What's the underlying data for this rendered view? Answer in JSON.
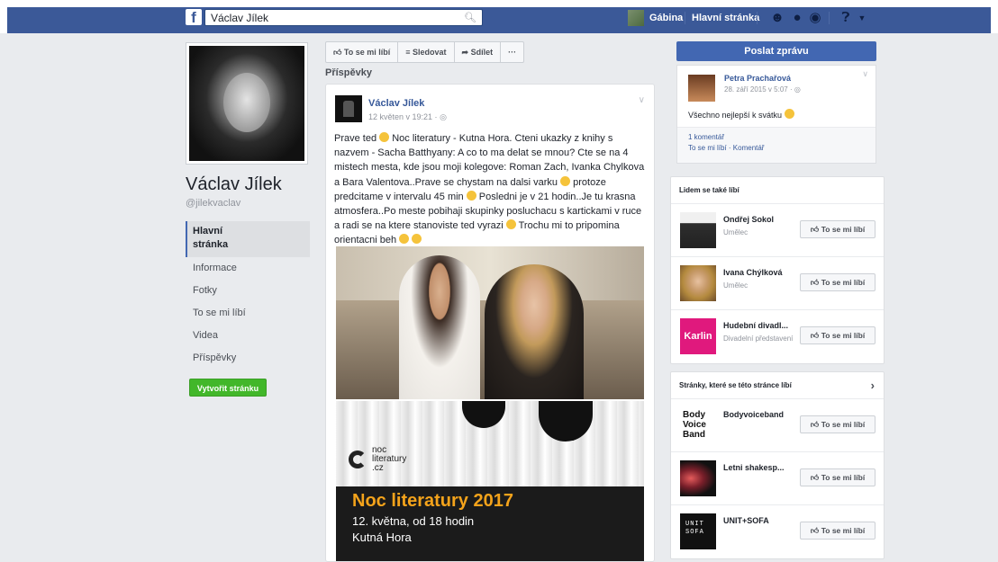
{
  "topbar": {
    "logo": "f",
    "search_value": "Václav Jílek",
    "user_name": "Gábina",
    "home_label": "Hlavní stránka",
    "colors": {
      "blue": "#3b5998",
      "green": "#42b72a"
    }
  },
  "page": {
    "name": "Václav Jílek",
    "handle": "@jilekvaclav"
  },
  "leftnav": {
    "items": [
      {
        "label": "Hlavní\nstránka",
        "active": true
      },
      {
        "label": "Informace"
      },
      {
        "label": "Fotky"
      },
      {
        "label": "To se mi líbí"
      },
      {
        "label": "Videa"
      },
      {
        "label": "Příspěvky"
      }
    ],
    "create_button": "Vytvořit stránku"
  },
  "actions": {
    "like": "To se mi líbí",
    "follow": "Sledovat",
    "share": "Sdílet",
    "more": "···"
  },
  "posts_title": "Příspěvky",
  "post": {
    "author": "Václav Jílek",
    "time": "12 květen v 19:21 · ",
    "text_parts": [
      "Prave ted ",
      " Noc literatury - Kutna Hora. Cteni ukazky z knihy s nazvem - Sacha Batthyany: A co to ma delat se mnou? Cte se na 4 mistech mesta, kde jsou moji kolegove: Roman Zach, Ivanka Chylkova a Bara Valentova..Prave se chystam na dalsi varku ",
      " protoze predcitame v intervalu 45 min ",
      " Posledni je v 21 hodin..Je tu krasna atmosfera..Po meste pobihaji skupinky posluchacu s kartickami v ruce a radi se na ktere stanoviste ted vyrazi ",
      " Trochu mi to pripomina orientacni beh "
    ],
    "poster": {
      "logo_text": "noc\nliteratury\n.cz",
      "title": "Noc literatury 2017",
      "line1": "12. května, od 18 hodin",
      "line2": "Kutná Hora"
    }
  },
  "right": {
    "send_button": "Poslat zprávu",
    "comment": {
      "name": "Petra Prachařová",
      "date": "28. září 2015 v 5:07 ·",
      "text": "Všechno nejlepší k svátku ",
      "count": "1 komentář",
      "actions": "To se mi líbí · Komentář"
    },
    "also_like": {
      "title": "Lidem se také líbí",
      "items": [
        {
          "name": "Ondřej Sokol",
          "category": "Umělec",
          "button": "To se mi líbí"
        },
        {
          "name": "Ivana Chýlková",
          "category": "Umělec",
          "button": "To se mi líbí"
        },
        {
          "name": "Hudební divadl...",
          "category": "Divadelní představení",
          "thumb_text": "Karlin",
          "button": "To se mi líbí"
        }
      ]
    },
    "pages_liked": {
      "title": "Stránky, které se této stránce líbí",
      "arrow": "›",
      "items": [
        {
          "name": "Bodyvoiceband",
          "thumb_text": "Body\nVoice\nBand",
          "button": "To se mi líbí"
        },
        {
          "name": "Letni shakesp...",
          "button": "To se mi líbí"
        },
        {
          "name": "UNIT+SOFA",
          "thumb_text": "UNIT\nSOFA",
          "button": "To se mi líbí"
        }
      ]
    }
  }
}
